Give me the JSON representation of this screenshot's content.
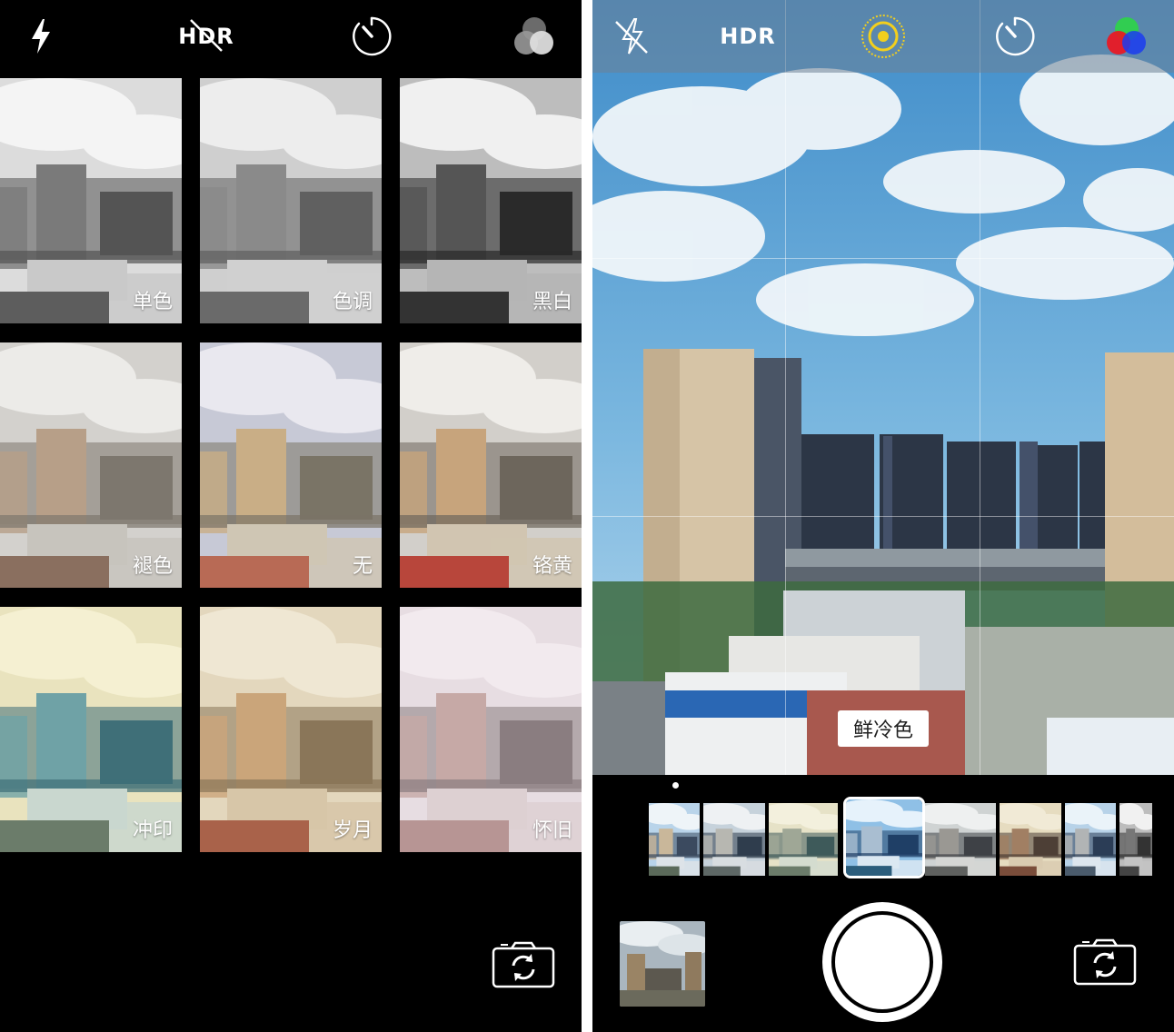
{
  "left_screen": {
    "toolbar": {
      "flash_icon": "flash-icon",
      "hdr_label": "HDR",
      "hdr_state": "off",
      "timer_icon": "timer-icon",
      "filters_icon": "filters-icon"
    },
    "filters": [
      {
        "label": "单色",
        "style": "mono"
      },
      {
        "label": "色调",
        "style": "tonal"
      },
      {
        "label": "黑白",
        "style": "noir"
      },
      {
        "label": "褪色",
        "style": "fade"
      },
      {
        "label": "无",
        "style": "none"
      },
      {
        "label": "铬黄",
        "style": "chrome"
      },
      {
        "label": "冲印",
        "style": "process"
      },
      {
        "label": "岁月",
        "style": "transfer"
      },
      {
        "label": "怀旧",
        "style": "instant"
      }
    ],
    "switch_camera_icon": "switch-camera-icon"
  },
  "right_screen": {
    "toolbar": {
      "flash_off_icon": "flash-off-icon",
      "hdr_label": "HDR",
      "live_photo_icon": "live-photo-icon",
      "timer_icon": "timer-icon",
      "filters_icon": "filters-color-icon"
    },
    "current_filter": "鲜冷色",
    "strip_thumbs": 8,
    "selected_strip_index": 3,
    "shutter_icon": "shutter-button",
    "switch_camera_icon": "switch-camera-icon"
  },
  "colors": {
    "accent_yellow": "#f2cf1d",
    "background": "#000000",
    "text": "#ffffff"
  }
}
